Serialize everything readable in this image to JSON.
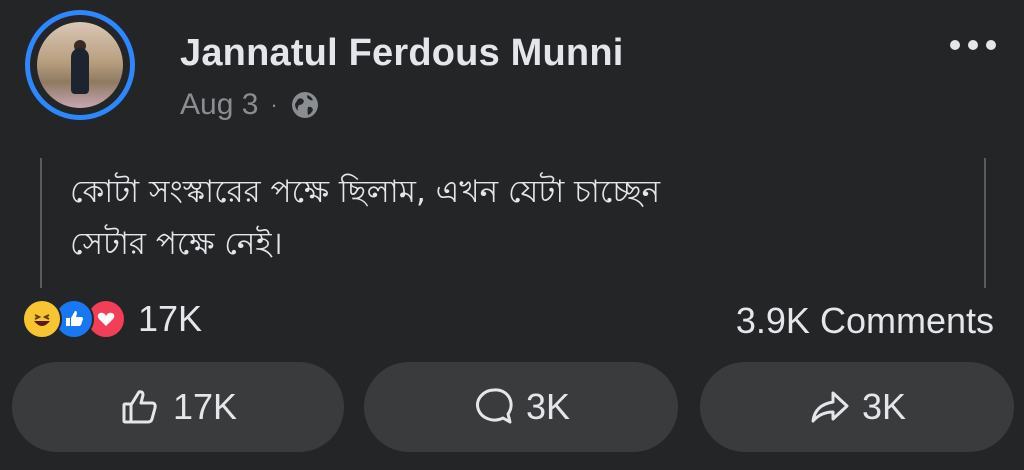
{
  "post": {
    "author": "Jannatul Ferdous Munni",
    "date": "Aug 3",
    "separator": "·",
    "privacy_icon": "globe-icon",
    "text_line1": "কোটা সংস্কারের পক্ষে ছিলাম, এখন যেটা চাচ্ছেন",
    "text_line2": "সেটার পক্ষে নেই।"
  },
  "reactions": {
    "icons": [
      "haha-icon",
      "like-icon",
      "love-icon"
    ],
    "count": "17K"
  },
  "comments_count": "3.9K Comments",
  "actions": {
    "like": "17K",
    "comment": "3K",
    "share": "3K"
  },
  "colors": {
    "background": "#242526",
    "button_bg": "#3a3b3c",
    "accent": "#2d88ff",
    "text": "#e4e6eb",
    "muted": "#8a8d91"
  }
}
